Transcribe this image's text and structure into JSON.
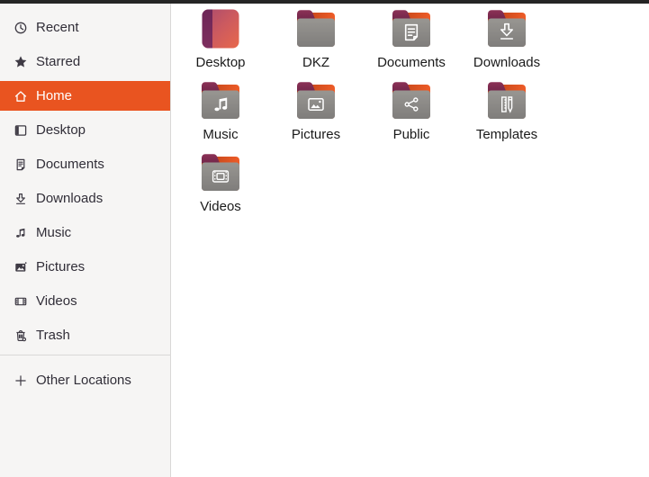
{
  "colors": {
    "accent": "#e95420",
    "sidebar_bg": "#f6f5f4",
    "top_strip": "#252525",
    "folder_front_gray": "#8c8c8c",
    "folder_back_orange": "#e95420",
    "folder_tab_maroon": "#7e2c50"
  },
  "sidebar": {
    "items": [
      {
        "label": "Recent",
        "icon": "clock-icon",
        "selected": false
      },
      {
        "label": "Starred",
        "icon": "star-icon",
        "selected": false
      },
      {
        "label": "Home",
        "icon": "home-icon",
        "selected": true
      },
      {
        "label": "Desktop",
        "icon": "desktop-icon",
        "selected": false
      },
      {
        "label": "Documents",
        "icon": "documents-icon",
        "selected": false
      },
      {
        "label": "Downloads",
        "icon": "downloads-icon",
        "selected": false
      },
      {
        "label": "Music",
        "icon": "music-icon",
        "selected": false
      },
      {
        "label": "Pictures",
        "icon": "pictures-icon",
        "selected": false
      },
      {
        "label": "Videos",
        "icon": "videos-icon",
        "selected": false
      },
      {
        "label": "Trash",
        "icon": "trash-icon",
        "selected": false
      }
    ],
    "footer_item": {
      "label": "Other Locations",
      "icon": "plus-icon"
    }
  },
  "main": {
    "folders": [
      {
        "name": "Desktop",
        "icon": "desktop-folder-icon"
      },
      {
        "name": "DKZ",
        "icon": "plain-folder-icon"
      },
      {
        "name": "Documents",
        "icon": "documents-folder-icon"
      },
      {
        "name": "Downloads",
        "icon": "downloads-folder-icon"
      },
      {
        "name": "Music",
        "icon": "music-folder-icon"
      },
      {
        "name": "Pictures",
        "icon": "pictures-folder-icon"
      },
      {
        "name": "Public",
        "icon": "public-folder-icon"
      },
      {
        "name": "Templates",
        "icon": "templates-folder-icon"
      },
      {
        "name": "Videos",
        "icon": "videos-folder-icon"
      }
    ]
  }
}
